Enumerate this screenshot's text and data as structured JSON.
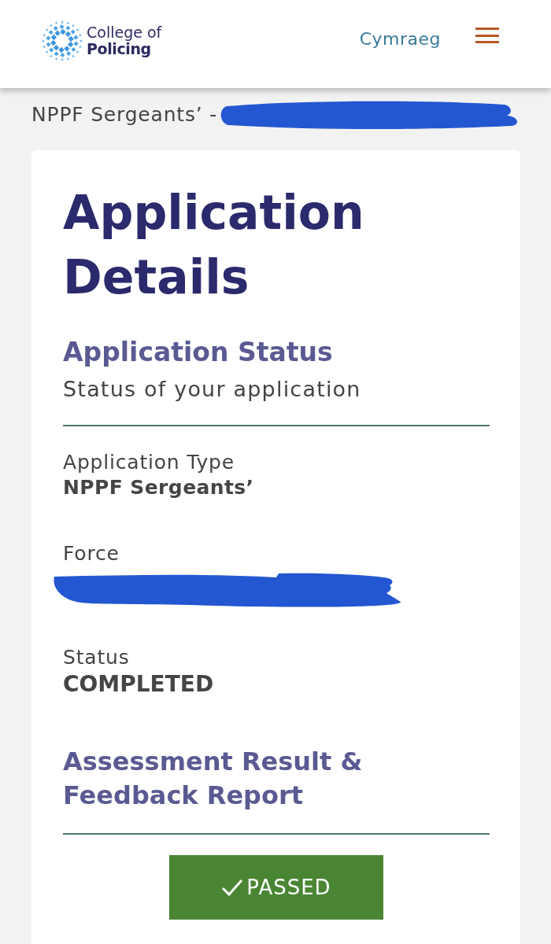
{
  "header": {
    "logo": {
      "line_1": "College of",
      "line_2": "Policing"
    },
    "language_link": "Cymraeg"
  },
  "breadcrumb": {
    "text": "NPPF Sergeants’ -",
    "redacted": true
  },
  "card": {
    "title": "Application Details",
    "section": {
      "heading": "Application Status",
      "subheading": "Status of your application"
    },
    "fields": [
      {
        "label": "Application Type",
        "value": "NPPF Sergeants’",
        "redacted": false
      },
      {
        "label": "Force",
        "redacted": true
      },
      {
        "label": "Status",
        "value": "COMPLETED",
        "redacted": false
      }
    ],
    "result": {
      "heading": "Assessment Result & Feedback Report",
      "outcome": "PASSED",
      "passed": true
    }
  }
}
